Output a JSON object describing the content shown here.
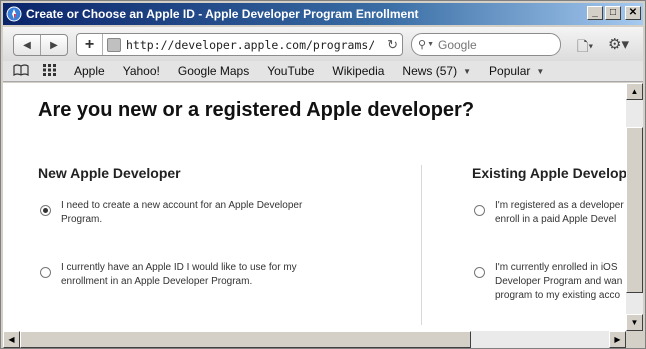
{
  "window": {
    "title": "Create or Choose an Apple ID - Apple Developer Program Enrollment",
    "controls": {
      "minimize": "_",
      "maximize": "□",
      "close": "✕"
    }
  },
  "toolbar": {
    "back_icon": "◀",
    "forward_icon": "▶",
    "add_icon": "+",
    "url": "http://developer.apple.com/programs/start/standard/",
    "reload_icon": "↻",
    "search_placeholder": "Google",
    "search_icon": "🔍",
    "page_menu_icon": "🗋▾",
    "settings_icon": "⚙▾"
  },
  "bookmarks": {
    "reading_icon": "📖",
    "grid_icon": "⋮⋮⋮",
    "items": [
      {
        "label": "Apple"
      },
      {
        "label": "Yahoo!"
      },
      {
        "label": "Google Maps"
      },
      {
        "label": "YouTube"
      },
      {
        "label": "Wikipedia"
      },
      {
        "label": "News (57)",
        "menu": true
      },
      {
        "label": "Popular",
        "menu": true
      }
    ]
  },
  "page": {
    "heading": "Are you new or a registered Apple developer?",
    "new_developer": {
      "title": "New Apple Developer",
      "options": [
        {
          "text": "I need to create a new account for an Apple Developer\nProgram.",
          "checked": true
        },
        {
          "text": "I currently have an Apple ID I would like to use for my\nenrollment in an Apple Developer Program.",
          "checked": false
        }
      ]
    },
    "existing_developer": {
      "title": "Existing Apple Develope",
      "options": [
        {
          "text": "I'm registered as a developer\nenroll in a paid Apple Devel",
          "checked": false
        },
        {
          "text": "I'm currently enrolled in iOS\nDeveloper Program and wan\nprogram to my existing acco",
          "checked": false
        }
      ]
    }
  },
  "scrollbars": {
    "up": "▲",
    "down": "▼",
    "left": "◀",
    "right": "▶"
  }
}
